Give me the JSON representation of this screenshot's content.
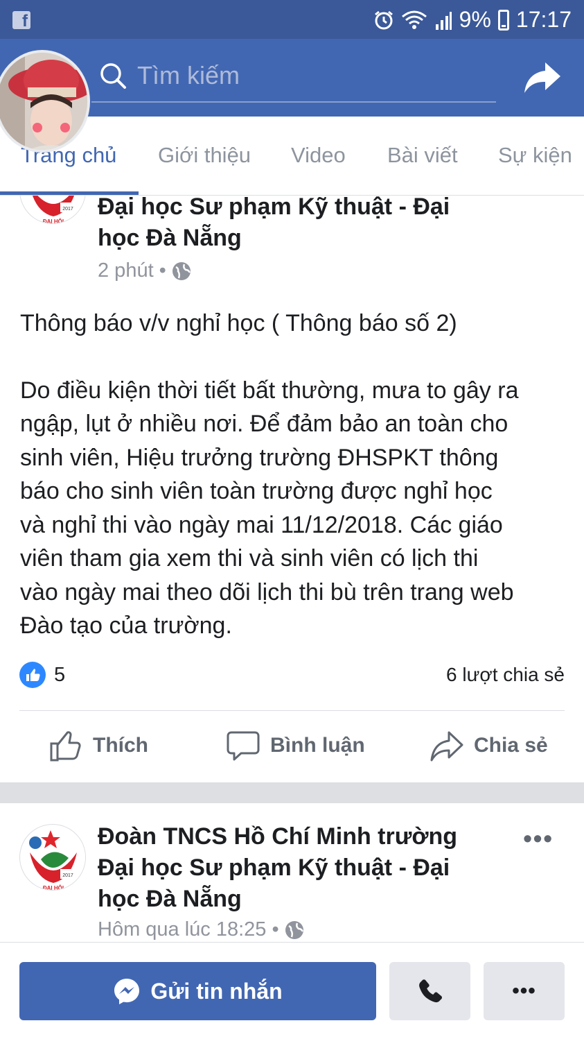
{
  "status_bar": {
    "app_icon": "facebook-icon",
    "battery": "9%",
    "time": "17:17"
  },
  "header": {
    "search_placeholder": "Tìm kiếm"
  },
  "tabs": [
    {
      "label": "Trang chủ",
      "active": true
    },
    {
      "label": "Giới thiệu"
    },
    {
      "label": "Video"
    },
    {
      "label": "Bài viết"
    },
    {
      "label": "Sự kiện"
    }
  ],
  "post1": {
    "author_line1": "Đại học Sư phạm Kỹ thuật - Đại",
    "author_line2": "học Đà Nẵng",
    "time": "2 phút",
    "body_title": "Thông báo v/v nghỉ học ( Thông báo số 2)",
    "body_lines": [
      "Do điều kiện thời tiết bất thường, mưa to gây ra",
      "ngập, lụt ở nhiều nơi. Để đảm bảo an toàn cho",
      "sinh viên, Hiệu trưởng trường ĐHSPKT thông",
      "báo cho sinh viên toàn trường được nghỉ học",
      "và nghỉ thi vào ngày mai 11/12/2018. Các giáo",
      "viên tham gia xem thi và sinh viên có lịch thi",
      "vào ngày mai theo dõi lịch thi bù trên trang web",
      "Đào tạo của trường."
    ],
    "like_count": "5",
    "share_count": "6 lượt chia sẻ",
    "actions": {
      "like": "Thích",
      "comment": "Bình luận",
      "share": "Chia sẻ"
    }
  },
  "post2": {
    "author_line1": "Đoàn TNCS Hồ Chí Minh trường",
    "author_line2": "Đại học Sư phạm Kỹ thuật - Đại",
    "author_line3": "học Đà Nẵng",
    "time": "Hôm qua lúc 18:25"
  },
  "bottom": {
    "message_button": "Gửi tin nhắn"
  },
  "colors": {
    "brand": "#4267b2",
    "status_bar": "#3b5998",
    "like_blue": "#2d88ff"
  }
}
